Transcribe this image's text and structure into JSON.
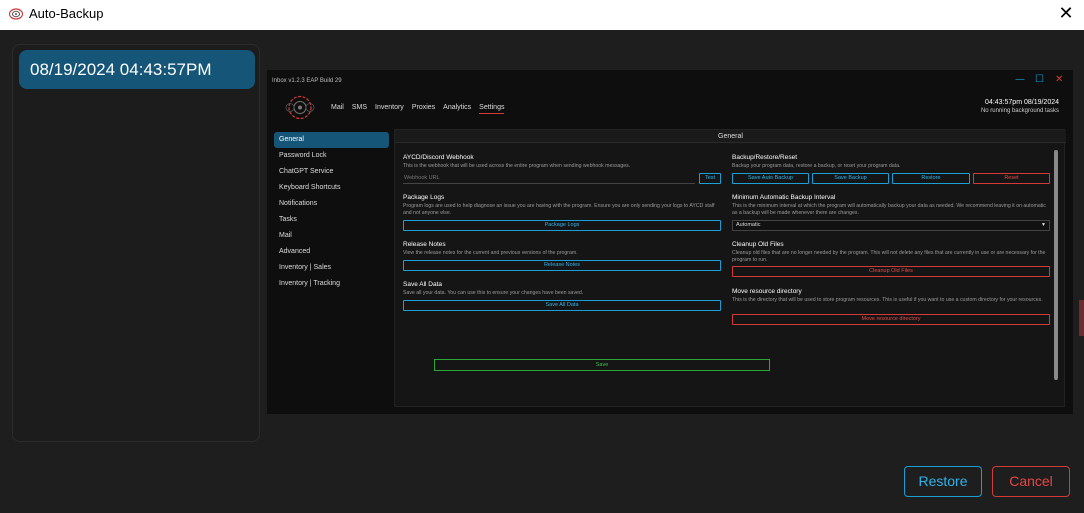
{
  "window": {
    "title": "Auto-Backup",
    "icon": "app-logo-icon",
    "close_icon": "close-icon"
  },
  "backups": [
    {
      "label": "08/19/2024 04:43:57PM"
    }
  ],
  "preview": {
    "build": "Inbox v1.2.3 EAP Build 29",
    "nav": [
      "Mail",
      "SMS",
      "Inventory",
      "Proxies",
      "Analytics",
      "Settings"
    ],
    "active_nav": "Settings",
    "clock": "04:43:57pm 08/19/2024",
    "tasks": "No running background tasks",
    "sidebar": [
      "General",
      "Password Lock",
      "ChatGPT Service",
      "Keyboard Shortcuts",
      "Notifications",
      "Tasks",
      "Mail",
      "Advanced",
      "Inventory | Sales",
      "Inventory | Tracking"
    ],
    "content_header": "General",
    "left": {
      "webhook": {
        "title": "AYCD/Discord Webhook",
        "desc": "This is the webhook that will be used across the entire program when sending webhook messages.",
        "placeholder": "Webhook URL",
        "test": "Test"
      },
      "logs": {
        "title": "Package Logs",
        "desc": "Program logs are used to help diagnose an issue you are having with the program. Ensure you are only sending your logs to AYCD staff and not anyone else.",
        "button": "Package Logs"
      },
      "notes": {
        "title": "Release Notes",
        "desc": "View the release notes for the current and previous versions of the program.",
        "button": "Release Notes"
      },
      "save": {
        "title": "Save All Data",
        "desc": "Save all your data. You can use this to ensure your changes have been saved.",
        "button": "Save All Data"
      }
    },
    "right": {
      "backup": {
        "title": "Backup/Restore/Reset",
        "desc": "Backup your program data, restore a backup, or reset your program data.",
        "buttons": [
          "Save Auto Backup",
          "Save Backup",
          "Restore",
          "Reset"
        ]
      },
      "interval": {
        "title": "Minimum Automatic Backup Interval",
        "desc": "This is the minimum interval at which the program will automatically backup your data as needed. We recommend leaving it on automatic as a backup will be made whenever there are changes.",
        "value": "Automatic"
      },
      "cleanup": {
        "title": "Cleanup Old Files",
        "desc": "Cleanup old files that are no longer needed by the program. This will not delete any files that are currently in use or are necessary for the program to run.",
        "button": "Cleanup Old Files"
      },
      "resource": {
        "title": "Move resource directory",
        "desc": "This is the directory that will be used to store program resources. This is useful if you want to use a custom directory for your resources.",
        "button": "Move resource directory"
      }
    },
    "save_label": "Save"
  },
  "footer": {
    "restore": "Restore",
    "cancel": "Cancel"
  },
  "colors": {
    "accent": "#1b9fd4",
    "danger": "#d33a3a",
    "success": "#2aa833",
    "selected": "#145578"
  }
}
